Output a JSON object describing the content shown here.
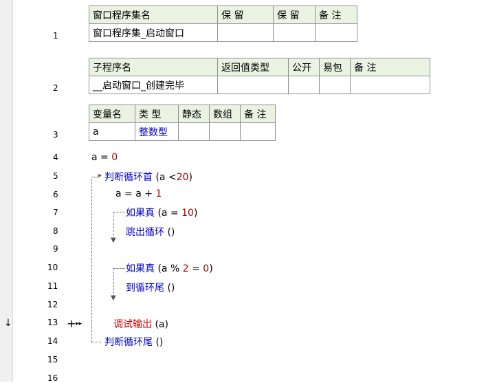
{
  "class_table": {
    "headers": [
      "窗口程序集名",
      "保 留",
      "保 留",
      "备 注"
    ],
    "row": [
      "窗口程序集_启动窗口",
      "",
      "",
      ""
    ]
  },
  "sub_table": {
    "headers": [
      "子程序名",
      "返回值类型",
      "公开",
      "易包",
      "备 注"
    ],
    "row": [
      "__启动窗口_创建完毕",
      "",
      "",
      "",
      ""
    ]
  },
  "var_table": {
    "headers": [
      "变量名",
      "类 型",
      "静态",
      "数组",
      "备 注"
    ],
    "row": [
      "a",
      "整数型",
      "",
      "",
      ""
    ]
  },
  "line_numbers": [
    "1",
    "2",
    "3",
    "4",
    "5",
    "6",
    "7",
    "8",
    "9",
    "10",
    "11",
    "12",
    "13",
    "14",
    "15",
    "16"
  ],
  "code": {
    "l4_var": "a",
    "l4_op": "=",
    "l4_num": "0",
    "l5_kw": "判断循环首",
    "l5_open": "(a <",
    "l5_num": "20",
    "l5_close": ")",
    "l6": "a = a +",
    "l6_num": "1",
    "l7_kw": "如果真",
    "l7_open": "(a =",
    "l7_num": "10",
    "l7_close": ")",
    "l8_kw": "跳出循环",
    "l8_args": "()",
    "l10_kw": "如果真",
    "l10_open": "(a %",
    "l10_num1": "2",
    "l10_mid": "=",
    "l10_num2": "0",
    "l10_close": ")",
    "l11_kw": "到循环尾",
    "l11_args": "()",
    "l13_kw": "调试输出",
    "l13_args": "(a)",
    "l14_kw": "判断循环尾",
    "l14_args": "()"
  },
  "markers": {
    "current_line_arrow": "↓",
    "expand_marker": "+",
    "step_marker": "▸▸"
  }
}
